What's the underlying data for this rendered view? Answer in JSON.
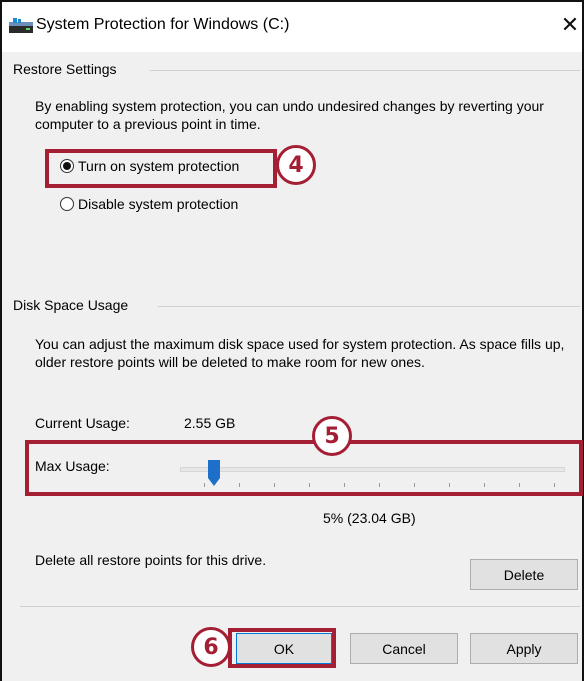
{
  "window": {
    "title": "System Protection for Windows (C:)",
    "close_glyph": "✕"
  },
  "restore_settings": {
    "group_label": "Restore Settings",
    "description": "By enabling system protection, you can undo undesired changes by reverting your computer to a previous point in time.",
    "options": [
      {
        "label": "Turn on system protection",
        "selected": true
      },
      {
        "label": "Disable system protection",
        "selected": false
      }
    ]
  },
  "disk_space": {
    "group_label": "Disk Space Usage",
    "description": "You can adjust the maximum disk space used for system protection. As space fills up, older restore points will be deleted to make room for new ones.",
    "current_usage_label": "Current Usage:",
    "current_usage_value": "2.55 GB",
    "max_usage_label": "Max Usage:",
    "max_usage_fraction": 0.05,
    "max_usage_readout": "5% (23.04 GB)",
    "delete_text": "Delete all restore points for this drive.",
    "delete_button": "Delete"
  },
  "footer": {
    "ok": "OK",
    "cancel": "Cancel",
    "apply": "Apply"
  },
  "callouts": {
    "step4": "4",
    "step5": "5",
    "step6": "6",
    "color": "#a41e34"
  },
  "icons": {
    "app": "drive-icon",
    "close": "close-icon"
  }
}
